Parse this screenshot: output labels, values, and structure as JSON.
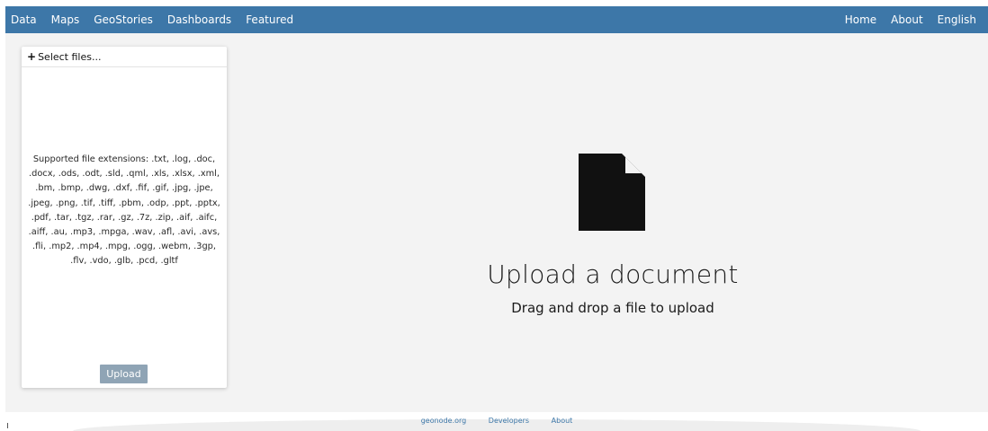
{
  "nav": {
    "left": [
      "Data",
      "Maps",
      "GeoStories",
      "Dashboards",
      "Featured"
    ],
    "right": [
      "Home",
      "About",
      "English"
    ]
  },
  "panel": {
    "select_files_label": "Select files...",
    "supported_extensions": "Supported file extensions: .txt, .log, .doc, .docx, .ods, .odt, .sld, .qml, .xls, .xlsx, .xml, .bm, .bmp, .dwg, .dxf, .fif, .gif, .jpg, .jpe, .jpeg, .png, .tif, .tiff, .pbm, .odp, .ppt, .pptx, .pdf, .tar, .tgz, .rar, .gz, .7z, .zip, .aif, .aifc, .aiff, .au, .mp3, .mpga, .wav, .afl, .avi, .avs, .fli, .mp2, .mp4, .mpg, .ogg, .webm, .3gp, .flv, .vdo, .glb, .pcd, .gltf",
    "upload_label": "Upload"
  },
  "dropzone": {
    "icon": "document-icon",
    "title": "Upload a document",
    "subtitle": "Drag and drop a file to upload"
  },
  "footer": {
    "links": [
      "geonode.org",
      "Developers",
      "About"
    ]
  },
  "colors": {
    "topbar": "#3d77a8",
    "background": "#f3f3f3",
    "upload_button": "#8fa4b5",
    "footer_link": "#3d77a8"
  }
}
